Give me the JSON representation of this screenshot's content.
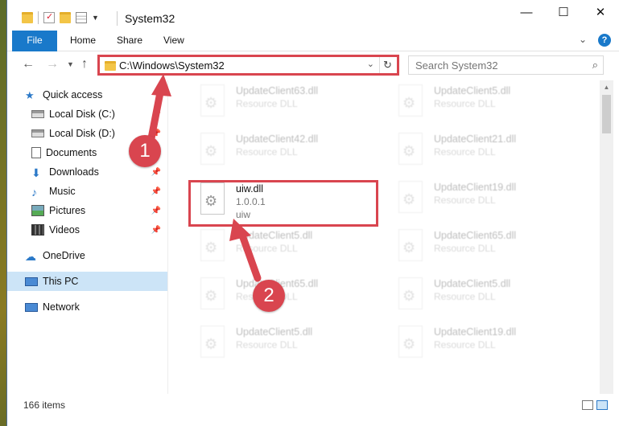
{
  "window": {
    "title": "System32",
    "controls": {
      "minimize": "—",
      "maximize": "☐",
      "close": "✕"
    }
  },
  "ribbon": {
    "tabs": [
      "File",
      "Home",
      "Share",
      "View"
    ],
    "expand_icon": "chevron-down-icon",
    "help_label": "?"
  },
  "address": {
    "path": "C:\\Windows\\System32",
    "dropdown_glyph": "⌄",
    "refresh_glyph": "↻"
  },
  "search": {
    "placeholder": "Search System32",
    "icon": "search-icon"
  },
  "nav": {
    "items": [
      {
        "label": "Quick access",
        "icon": "star-icon",
        "pinned": false
      },
      {
        "label": "Local Disk (C:)",
        "icon": "disk-icon",
        "pinned": true
      },
      {
        "label": "Local Disk (D:)",
        "icon": "disk-icon",
        "pinned": true
      },
      {
        "label": "Documents",
        "icon": "documents-icon",
        "pinned": true
      },
      {
        "label": "Downloads",
        "icon": "downloads-icon",
        "pinned": true
      },
      {
        "label": "Music",
        "icon": "music-icon",
        "pinned": true
      },
      {
        "label": "Pictures",
        "icon": "pictures-icon",
        "pinned": true
      },
      {
        "label": "Videos",
        "icon": "videos-icon",
        "pinned": true
      },
      {
        "label": "OneDrive",
        "icon": "cloud-icon",
        "pinned": false
      },
      {
        "label": "This PC",
        "icon": "pc-icon",
        "pinned": false,
        "selected": true
      },
      {
        "label": "Network",
        "icon": "network-icon",
        "pinned": false
      }
    ],
    "pin_glyph": "📌"
  },
  "files": [
    {
      "name": "UpdateClient63.dll",
      "line2": "Resource DLL",
      "line3": "",
      "faded": true
    },
    {
      "name": "UpdateClient5.dll",
      "line2": "Resource DLL",
      "line3": "",
      "faded": true
    },
    {
      "name": "UpdateClient42.dll",
      "line2": "Resource DLL",
      "line3": "",
      "faded": true
    },
    {
      "name": "UpdateClient21.dll",
      "line2": "Resource DLL",
      "line3": "",
      "faded": true
    },
    {
      "name": "uiw.dll",
      "line2": "1.0.0.1",
      "line3": "uiw",
      "faded": false
    },
    {
      "name": "UpdateClient19.dll",
      "line2": "Resource DLL",
      "line3": "",
      "faded": true
    },
    {
      "name": "UpdateClient5.dll",
      "line2": "Resource DLL",
      "line3": "",
      "faded": true
    },
    {
      "name": "UpdateClient65.dll",
      "line2": "Resource DLL",
      "line3": "",
      "faded": true
    },
    {
      "name": "UpdateClient65.dll",
      "line2": "Resource DLL",
      "line3": "",
      "faded": true
    },
    {
      "name": "UpdateClient5.dll",
      "line2": "Resource DLL",
      "line3": "",
      "faded": true
    },
    {
      "name": "UpdateClient5.dll",
      "line2": "Resource DLL",
      "line3": "",
      "faded": true
    },
    {
      "name": "UpdateClient19.dll",
      "line2": "Resource DLL",
      "line3": "",
      "faded": true
    }
  ],
  "status": {
    "count": "166 items"
  },
  "annotations": {
    "badge1": "1",
    "badge2": "2",
    "color": "#d9454f"
  },
  "colors": {
    "accent": "#1979ca",
    "selection": "#cce4f7",
    "highlight": "#d9454f"
  }
}
